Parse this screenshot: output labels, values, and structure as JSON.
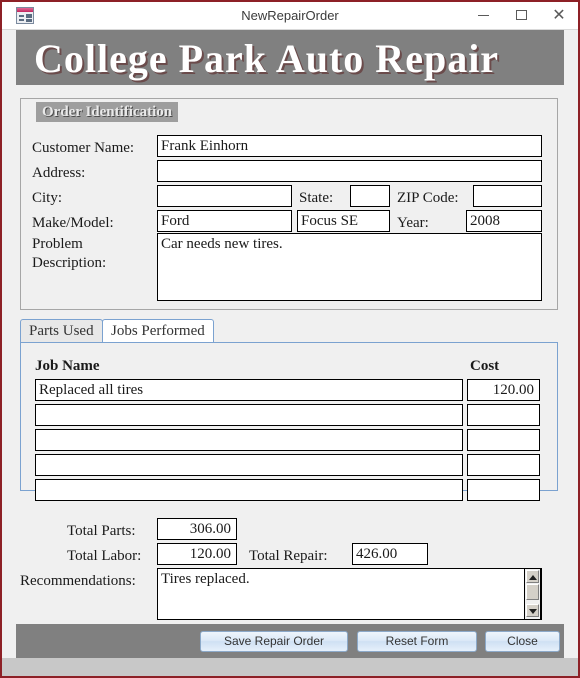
{
  "window": {
    "title": "NewRepairOrder",
    "icon": "form-window-icon",
    "controls": {
      "minimize": "–",
      "maximize": "□",
      "close": "✕"
    }
  },
  "banner": {
    "title": "College Park Auto Repair"
  },
  "order_identification": {
    "legend": "Order Identification",
    "fields": {
      "customer_name": {
        "label": "Customer Name:",
        "value": "Frank Einhorn"
      },
      "address": {
        "label": "Address:",
        "value": ""
      },
      "city": {
        "label": "City:",
        "value": ""
      },
      "state": {
        "label": "State:",
        "value": ""
      },
      "zip_code": {
        "label": "ZIP Code:",
        "value": ""
      },
      "make_model": {
        "label": "Make/Model:",
        "make": "Ford",
        "model": "Focus SE"
      },
      "year": {
        "label": "Year:",
        "value": "2008"
      },
      "problem_description": {
        "label_line1": "Problem",
        "label_line2": "Description:",
        "value": "Car needs new tires."
      }
    }
  },
  "tabs": [
    {
      "label": "Parts Used",
      "active": false
    },
    {
      "label": "Jobs Performed",
      "active": true
    }
  ],
  "jobs_table": {
    "columns": {
      "name": "Job Name",
      "cost": "Cost"
    },
    "rows": [
      {
        "name": "Replaced all tires",
        "cost": "120.00"
      },
      {
        "name": "",
        "cost": ""
      },
      {
        "name": "",
        "cost": ""
      },
      {
        "name": "",
        "cost": ""
      },
      {
        "name": "",
        "cost": ""
      }
    ]
  },
  "totals": {
    "total_parts": {
      "label": "Total Parts:",
      "value": "306.00"
    },
    "total_labor": {
      "label": "Total Labor:",
      "value": "120.00"
    },
    "total_repair": {
      "label": "Total Repair:",
      "value": "426.00"
    },
    "recommendations": {
      "label": "Recommendations:",
      "value": "Tires replaced."
    }
  },
  "buttons": {
    "save": "Save Repair Order",
    "reset": "Reset Form",
    "close": "Close"
  },
  "colors": {
    "window_border": "#8d2026",
    "banner_bg": "#808080",
    "footer_bg": "#808080",
    "client_bg": "#f0f0f0",
    "tab_border": "#7ba2d0",
    "legend_bg": "#9e9e9e"
  }
}
